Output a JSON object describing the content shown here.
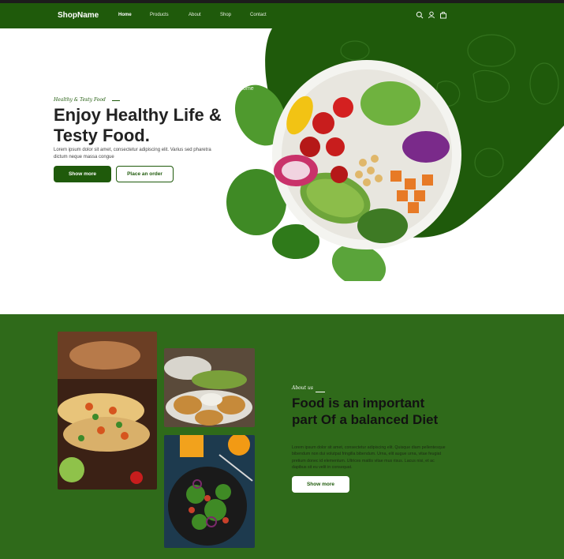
{
  "nav": {
    "logo": "ShopName",
    "links": [
      "Home",
      "Products",
      "About",
      "Shop",
      "Contact"
    ],
    "active": "Home",
    "icons": [
      "search-icon",
      "user-icon",
      "bag-icon"
    ]
  },
  "hero": {
    "tagline": "Healthy & Testy Food",
    "title": "Enjoy Healthy Life & Testy Food.",
    "description": "Lorem ipsum dolor sit amet, consectetur adipiscing elit. Varius sed pharetra dictum neque massa congue",
    "primary_button": "Show more",
    "secondary_button": "Place an order",
    "image_overlay_text": "Home",
    "background_watermark": "Bread"
  },
  "about": {
    "tag": "About us",
    "title": "Food is an important part Of a balanced Diet",
    "description": "Lorem ipsum dolor sit amet, consectetur adipiscing elit. Quisque diam pellentesque bibendum non dui volutpat fringilla bibendum. Urna, elit augue urna, vitae feugiat pretium donec id elementum. Ultrices mattis vitae mus risus. Lacus nisi, et ac dapibus sit eu velit in consequat.",
    "button": "Show more"
  },
  "colors": {
    "primary": "#1f5a0b",
    "about_bg": "#2f6a1a",
    "topbar": "#1c1c1c"
  }
}
